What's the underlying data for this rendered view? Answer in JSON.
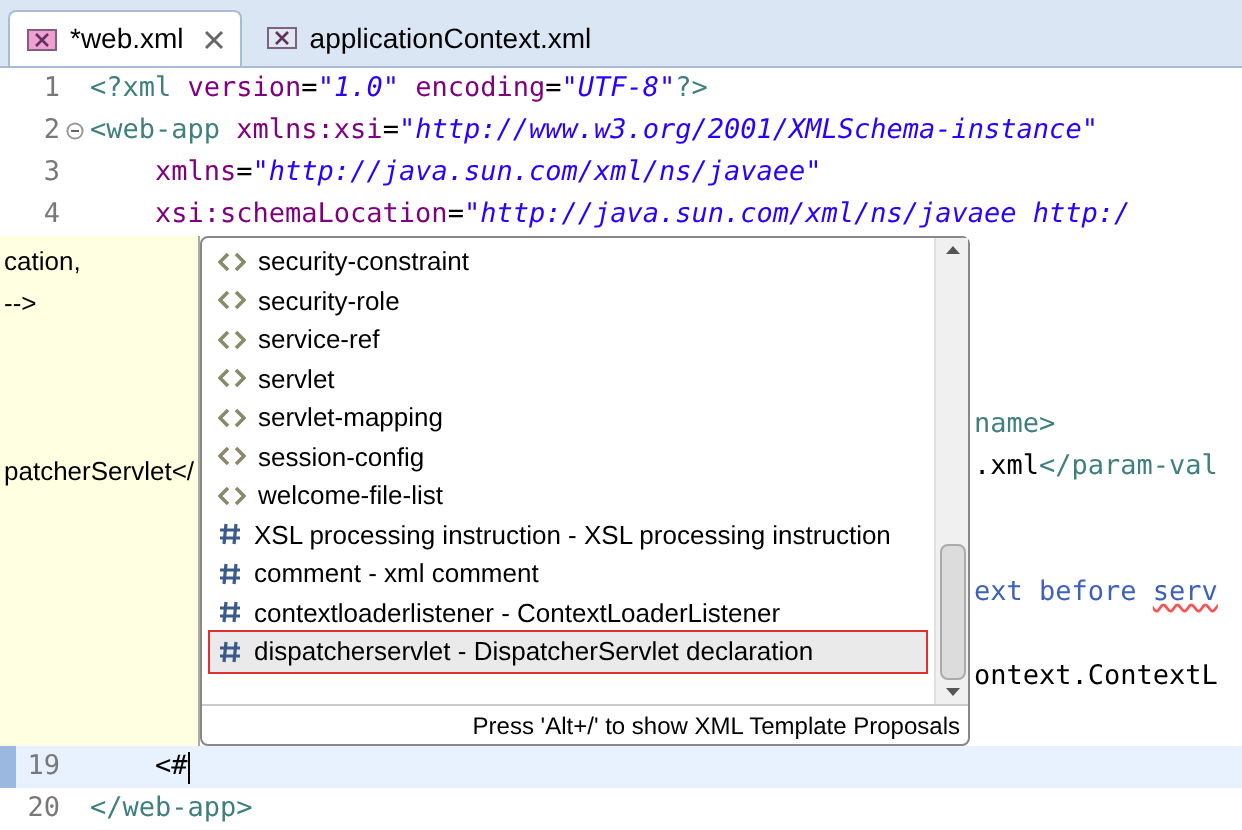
{
  "tabs": [
    {
      "label": "*web.xml",
      "selected": true,
      "closable": true
    },
    {
      "label": "applicationContext.xml",
      "selected": false,
      "closable": false
    }
  ],
  "code_top": [
    {
      "number": "1",
      "fold": false,
      "tokens": [
        {
          "text": "<?xml",
          "kind": "tag"
        },
        {
          "text": " version",
          "kind": "attr"
        },
        {
          "text": "=",
          "kind": "plain"
        },
        {
          "text": "\"1.0\"",
          "kind": "value"
        },
        {
          "text": " encoding",
          "kind": "attr"
        },
        {
          "text": "=",
          "kind": "plain"
        },
        {
          "text": "\"UTF-8\"",
          "kind": "value"
        },
        {
          "text": "?>",
          "kind": "tag"
        }
      ]
    },
    {
      "number": "2",
      "fold": true,
      "tokens": [
        {
          "text": "<web-app",
          "kind": "tag"
        },
        {
          "text": " xmlns:xsi",
          "kind": "attr"
        },
        {
          "text": "=",
          "kind": "plain"
        },
        {
          "text": "\"http://www.w3.org/2001/XMLSchema-instance\"",
          "kind": "value"
        }
      ]
    },
    {
      "number": "3",
      "fold": false,
      "tokens": [
        {
          "text": "    xmlns",
          "kind": "attr"
        },
        {
          "text": "=",
          "kind": "plain"
        },
        {
          "text": "\"http://java.sun.com/xml/ns/javaee\"",
          "kind": "value"
        }
      ]
    },
    {
      "number": "4",
      "fold": false,
      "tokens": [
        {
          "text": "    xsi:schemaLocation",
          "kind": "attr"
        },
        {
          "text": "=",
          "kind": "plain"
        },
        {
          "text": "\"http://java.sun.com/xml/ns/javaee http:/",
          "kind": "value"
        }
      ]
    }
  ],
  "doc_popup": [
    "cation,",
    "-->",
    "patcherServlet</"
  ],
  "proposals": {
    "items": [
      {
        "kind": "element",
        "label": "security-constraint",
        "selected": false
      },
      {
        "kind": "element",
        "label": "security-role",
        "selected": false
      },
      {
        "kind": "element",
        "label": "service-ref",
        "selected": false
      },
      {
        "kind": "element",
        "label": "servlet",
        "selected": false
      },
      {
        "kind": "element",
        "label": "servlet-mapping",
        "selected": false
      },
      {
        "kind": "element",
        "label": "session-config",
        "selected": false
      },
      {
        "kind": "element",
        "label": "welcome-file-list",
        "selected": false
      },
      {
        "kind": "template",
        "label": "XSL processing instruction - XSL processing instruction",
        "selected": false
      },
      {
        "kind": "template",
        "label": "comment - xml comment",
        "selected": false
      },
      {
        "kind": "template",
        "label": "contextloaderlistener - ContextLoaderListener",
        "selected": false
      },
      {
        "kind": "template",
        "label": "dispatcherservlet - DispatcherServlet declaration",
        "selected": true
      }
    ],
    "footer": "Press 'Alt+/' to show XML Template Proposals"
  },
  "code_fragments": [
    {
      "tokens": [
        {
          "text": "name>",
          "kind": "tag"
        }
      ]
    },
    {
      "tokens": [
        {
          "text": ".xml",
          "kind": "plain"
        },
        {
          "text": "</param-val",
          "kind": "tag"
        }
      ]
    },
    {
      "tokens": [
        {
          "text": "ext before ",
          "kind": "comment"
        },
        {
          "text": "serv",
          "kind": "misspelled"
        }
      ]
    },
    {
      "tokens": [
        {
          "text": "ontext.ContextL",
          "kind": "plain"
        }
      ]
    }
  ],
  "code_bottom": [
    {
      "number": "19",
      "current": true,
      "tokens": [
        {
          "text": "    <#",
          "kind": "plain"
        }
      ]
    },
    {
      "number": "20",
      "current": false,
      "tokens": [
        {
          "text": "</web-app>",
          "kind": "tag"
        }
      ]
    }
  ]
}
